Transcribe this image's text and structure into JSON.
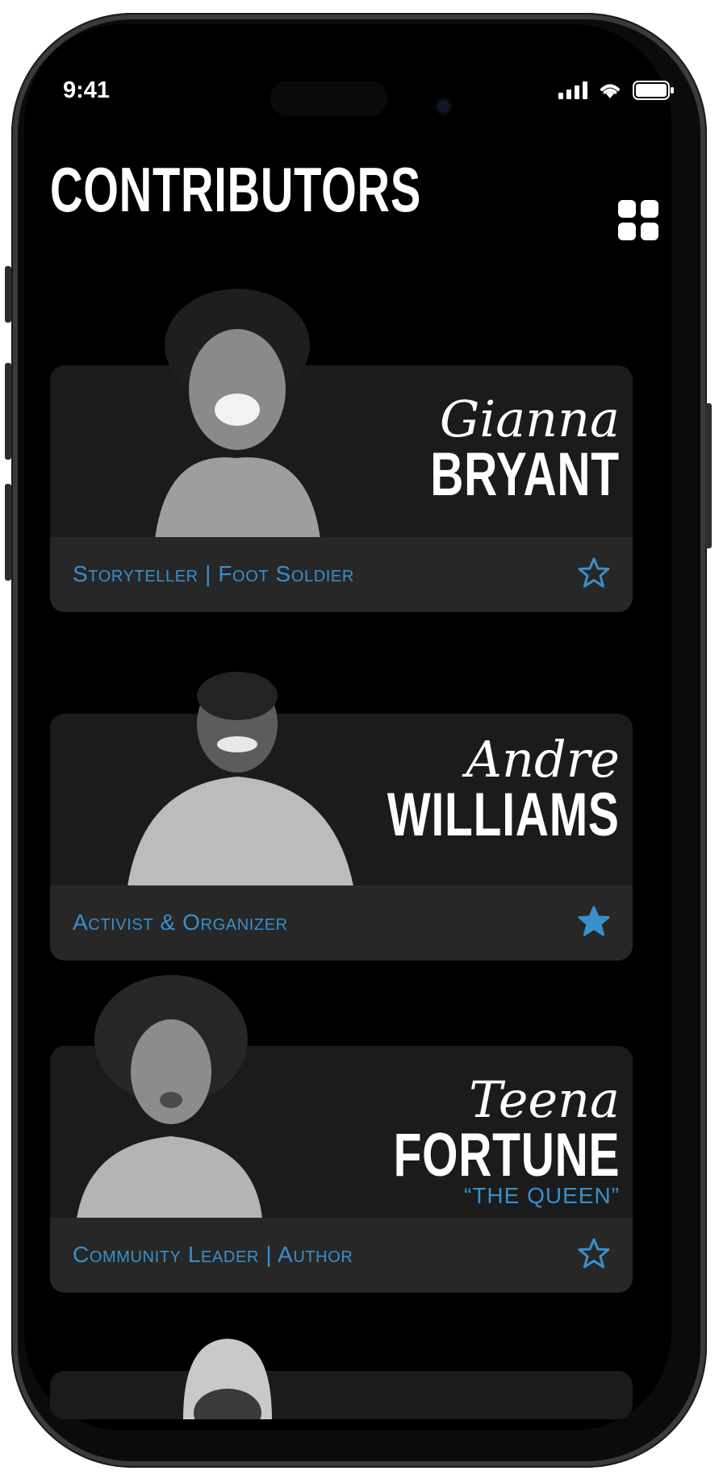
{
  "status_bar": {
    "time": "9:41"
  },
  "header": {
    "title": "CONTRIBUTORS",
    "view_toggle_icon": "grid-view-icon"
  },
  "colors": {
    "accent": "#3a8fcb",
    "card_bg": "#1b1b1b",
    "footer_bg": "#272727"
  },
  "contributors": [
    {
      "first_name": "Gianna",
      "last_name": "BRYANT",
      "nickname": "",
      "role": "Storyteller | Foot Soldier",
      "favorite": false
    },
    {
      "first_name": "Andre",
      "last_name": "WILLIAMS",
      "nickname": "",
      "role": "Activist & Organizer",
      "favorite": true
    },
    {
      "first_name": "Teena",
      "last_name": "FORTUNE",
      "nickname": "“THE QUEEN”",
      "role": "Community Leader | Author",
      "favorite": false
    }
  ]
}
